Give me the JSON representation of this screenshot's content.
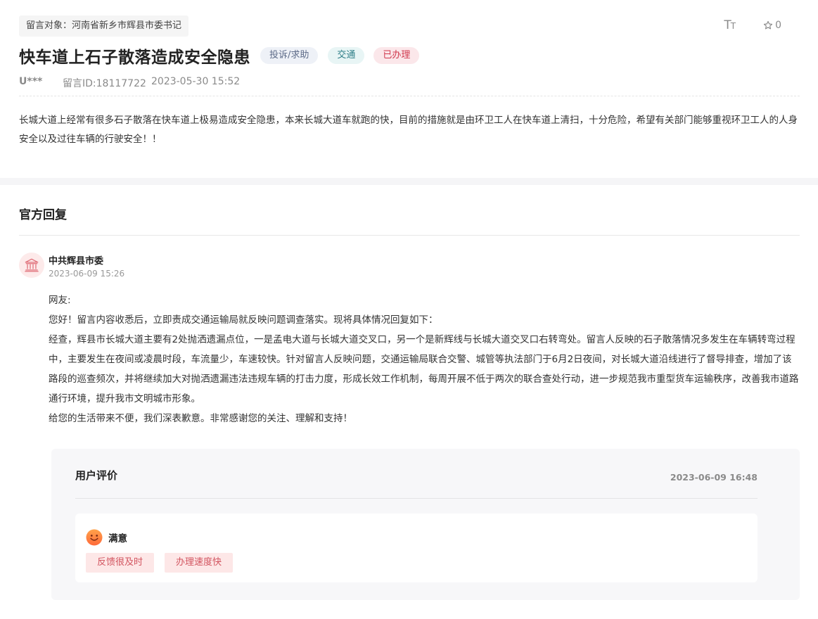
{
  "message": {
    "recipient": "留言对象：河南省新乡市辉县市委书记",
    "title": "快车道上石子散落造成安全隐患",
    "tags": [
      "投诉/求助",
      "交通",
      "已办理"
    ],
    "user": "U***",
    "message_id": "留言ID:18117722",
    "datetime": "2023-05-30 15:52",
    "content": "长城大道上经常有很多石子散落在快车道上极易造成安全隐患，本来长城大道车就跑的快，目前的措施就是由环卫工人在快车道上清扫，十分危险，希望有关部门能够重视环卫工人的人身安全以及过往车辆的行驶安全！！"
  },
  "toolbar": {
    "font_size_icon": "font-size-icon",
    "favorite_icon": "star-icon",
    "favorite_count": "0"
  },
  "reply": {
    "heading": "官方回复",
    "org_icon": "government-building-icon",
    "org_name": "中共辉县市委",
    "datetime": "2023-06-09 15:26",
    "paragraphs": [
      "网友:",
      "您好！留言内容收悉后，立即责成交通运输局就反映问题调查落实。现将具体情况回复如下：",
      "经查，辉县市长城大道主要有2处抛洒遗漏点位，一是孟电大道与长城大道交叉口，另一个是新辉线与长城大道交叉口右转弯处。留言人反映的石子散落情况多发生在车辆转弯过程中，主要发生在夜间或凌晨时段，车流量少，车速较快。针对留言人反映问题，交通运输局联合交警、城管等执法部门于6月2日夜间，对长城大道沿线进行了督导排查，增加了该路段的巡查频次，并将继续加大对抛洒遗漏违法违规车辆的打击力度，形成长效工作机制，每周开展不低于两次的联合查处行动，进一步规范我市重型货车运输秩序，改善我市道路通行环境，提升我市文明城市形象。",
      "给您的生活带来不便，我们深表歉意。非常感谢您的关注、理解和支持！"
    ]
  },
  "evaluation": {
    "title": "用户评价",
    "datetime": "2023-06-09 16:48",
    "mood_icon": "smile-icon",
    "mood": "满意",
    "chips": [
      "反馈很及时",
      "办理速度快"
    ]
  },
  "colors": {
    "accent_red": "#d0384d",
    "tag_blue_bg": "#eef1f7",
    "tag_teal_bg": "#e8f5f5",
    "tag_red_bg": "#fbe7ea",
    "chip_bg": "#fde7e7"
  }
}
